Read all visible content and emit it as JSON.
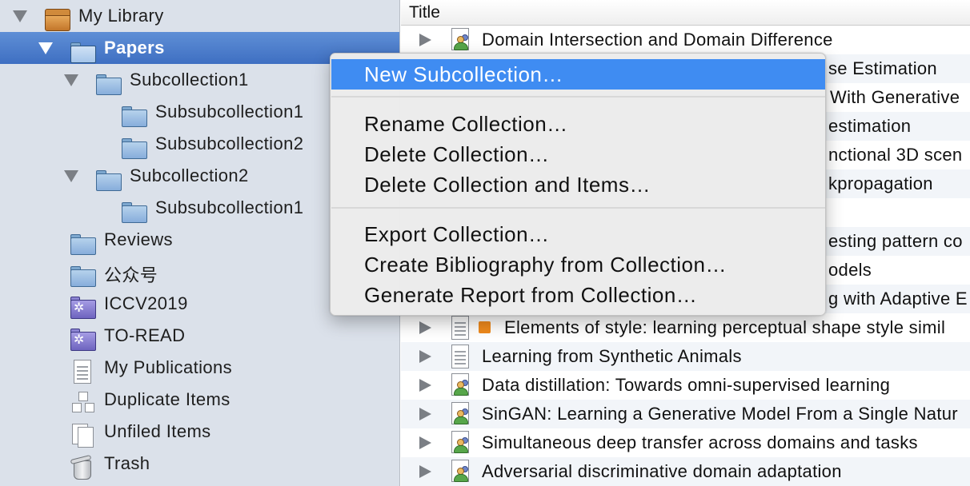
{
  "collections_pane": {
    "library": {
      "label": "My Library"
    },
    "items": [
      {
        "label": "Papers",
        "selected": true
      },
      {
        "label": "Subcollection1"
      },
      {
        "label": "Subsubcollection1"
      },
      {
        "label": "Subsubcollection2"
      },
      {
        "label": "Subcollection2"
      },
      {
        "label": "Subsubcollection1"
      },
      {
        "label": "Reviews"
      },
      {
        "label": "公众号"
      },
      {
        "label": "ICCV2019"
      },
      {
        "label": "TO-READ"
      },
      {
        "label": "My Publications"
      },
      {
        "label": "Duplicate Items"
      },
      {
        "label": "Unfiled Items"
      },
      {
        "label": "Trash"
      }
    ]
  },
  "items_pane": {
    "column_title": "Title",
    "rows": [
      {
        "title": "Domain Intersection and Domain Difference"
      },
      {
        "title": "se Estimation"
      },
      {
        "title": "With Generative"
      },
      {
        "title": "estimation"
      },
      {
        "title": "nctional 3D scen"
      },
      {
        "title": "kpropagation"
      },
      {
        "title": ""
      },
      {
        "title": "esting pattern co"
      },
      {
        "title": "odels"
      },
      {
        "title": "g with Adaptive E"
      },
      {
        "title": "Elements of style: learning perceptual shape style simil",
        "tag_color": "#ef8a1d"
      },
      {
        "title": "Learning from Synthetic Animals"
      },
      {
        "title": "Data distillation: Towards omni-supervised learning"
      },
      {
        "title": "SinGAN: Learning a Generative Model From a Single Natur"
      },
      {
        "title": "Simultaneous deep transfer across domains and tasks"
      },
      {
        "title": "Adversarial discriminative domain adaptation"
      }
    ]
  },
  "context_menu": {
    "items": [
      {
        "label": "New Subcollection…",
        "highlighted": true
      },
      {
        "label": "Rename Collection…"
      },
      {
        "label": "Delete Collection…"
      },
      {
        "label": "Delete Collection and Items…"
      },
      {
        "label": "Export Collection…"
      },
      {
        "label": "Create Bibliography from Collection…"
      },
      {
        "label": "Generate Report from Collection…"
      }
    ]
  },
  "colors": {
    "selection": "#3e6fc2",
    "menu_highlight": "#3f8cf2",
    "sidebar_bg": "#dbe1ea"
  }
}
